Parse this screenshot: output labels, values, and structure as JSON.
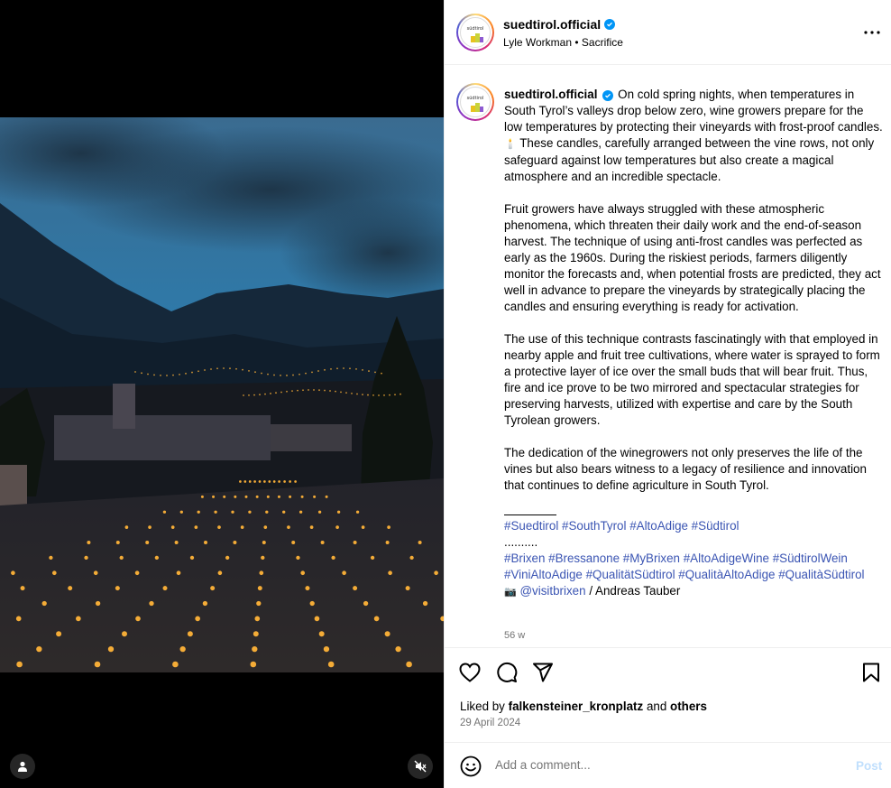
{
  "post": {
    "username": "suedtirol.official",
    "audio_line": "Lyle Workman • Sacrifice",
    "avatar_text": "südtirol",
    "caption": {
      "intro": "On cold spring nights, when temperatures in South Tyrol’s valleys drop below zero, wine growers prepare for the low temperatures by protecting their vineyards with frost-proof candles.",
      "candle_emoji": "🕯️",
      "intro_cont": "These candles, carefully arranged between the vine rows, not only safeguard against low temperatures but also create a magical atmosphere and an incredible spectacle.",
      "para2": "Fruit growers have always struggled with these atmospheric phenomena, which threaten their daily work and the end-of-season harvest. The technique of using anti-frost candles was perfected as early as the 1960s. During the riskiest periods, farmers diligently monitor the forecasts and, when potential frosts are predicted, they act well in advance to prepare the vineyards by strategically placing the candles and ensuring everything is ready for activation.",
      "para3": "The use of this technique contrasts fascinatingly with that employed in nearby apple and fruit tree cultivations, where water is sprayed to form a protective layer of ice over the small buds that will bear fruit. Thus, fire and ice prove to be two mirrored and spectacular strategies for preserving harvests, utilized with expertise and care by the South Tyrolean growers.",
      "para4": "The dedication of the winegrowers not only preserves the life of the vines but also bears witness to a legacy of resilience and innovation that continues to define agriculture in South Tyrol.",
      "hashtags1": "#Suedtirol #SouthTyrol #AltoAdige #Südtirol",
      "dots": "..........",
      "hashtags2": "#Brixen #Bressanone #MyBrixen #AltoAdigeWine #SüdtirolWein #ViniAltoAdige #QualitätSüdtirol #QualitàAltoAdige #QualitàSüdtirol",
      "camera_emoji": "📷",
      "credit_mention": "@visitbrixen",
      "credit_rest": "/ Andreas Tauber"
    },
    "time_ago": "56 w",
    "liked_prefix": "Liked by",
    "liked_user": "falkensteiner_kronplatz",
    "liked_and": "and",
    "liked_others": "others",
    "date": "29 April 2024",
    "comment_placeholder": "Add a comment...",
    "post_button": "Post"
  },
  "icons": {
    "more": "more-options-icon",
    "like": "heart-icon",
    "comment": "comment-icon",
    "share": "share-icon",
    "save": "bookmark-icon",
    "emoji": "emoji-icon",
    "user": "user-tag-icon",
    "mute": "audio-muted-icon"
  },
  "colors": {
    "verified": "#0095f6",
    "link": "#3b55b3",
    "post_disabled": "#c0dffd"
  }
}
